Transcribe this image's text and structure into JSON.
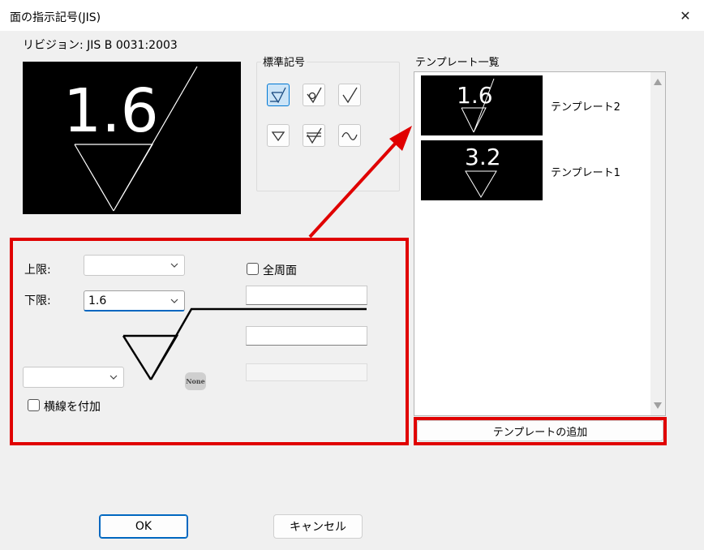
{
  "window": {
    "title": "面の指示記号(JIS)",
    "close_glyph": "✕"
  },
  "revision": "リビジョン: JIS B 0031:2003",
  "preview": {
    "value": "1.6"
  },
  "standard_symbols": {
    "label": "標準記号",
    "icons": [
      "removal-required-icon",
      "removal-prohibited-icon",
      "basic-symbol-icon",
      "triangle-icon",
      "lay-direction-icon",
      "wave-icon"
    ]
  },
  "template_list": {
    "label": "テンプレート一覧",
    "items": [
      {
        "value": "1.6",
        "name": "テンプレート2"
      },
      {
        "value": "3.2",
        "name": "テンプレート1"
      }
    ],
    "add_button": "テンプレートの追加"
  },
  "form": {
    "upper_label": "上限:",
    "upper_value": "",
    "lower_label": "下限:",
    "lower_value": "1.6",
    "all_around_label": "全周面",
    "all_around_checked": false,
    "bottom_combo_value": "",
    "horizontal_line_label": "横線を付加",
    "horizontal_line_checked": false,
    "none_badge": "None"
  },
  "buttons": {
    "ok": "OK",
    "cancel": "キャンセル"
  },
  "colors": {
    "highlight_red": "#e00000",
    "accent_blue": "#0067c0"
  }
}
